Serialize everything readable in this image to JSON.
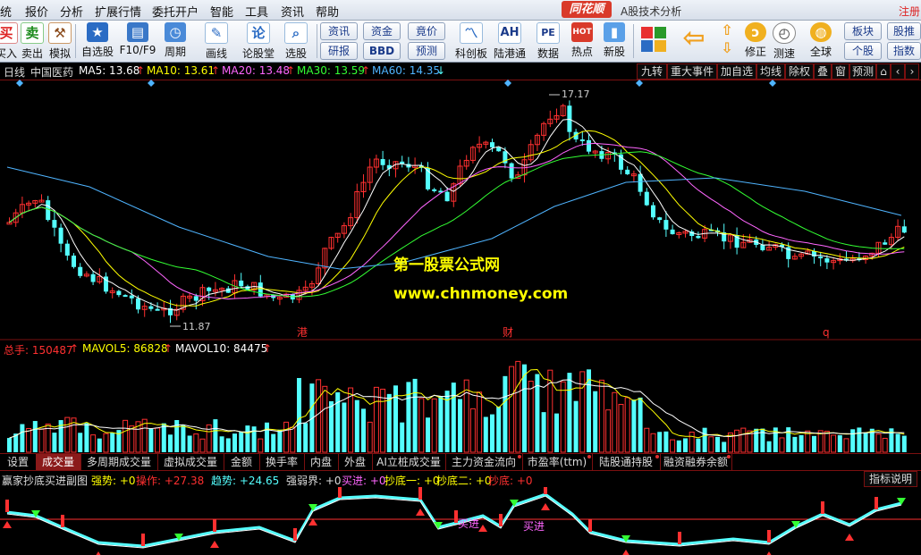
{
  "menu": {
    "items": [
      "统",
      "报价",
      "分析",
      "扩展行情",
      "委托开户",
      "智能",
      "工具",
      "资讯",
      "帮助"
    ],
    "brand": "同花顺",
    "title": "A股技术分析",
    "register": "注册"
  },
  "toolbar": {
    "buy": "买入",
    "sell": "卖出",
    "simulate": "模拟",
    "watchlist": "自选股",
    "f10": "F10/F9",
    "period": "周期",
    "draw": "画线",
    "forum": "论股堂",
    "pick": "选股",
    "news": "资讯",
    "research": "研报",
    "capital": "资金",
    "bbd": "BBD",
    "auction": "竟价",
    "forecast": "预测",
    "sci": "科创板",
    "hk": "陆港通",
    "data": "数据",
    "hot": "热点",
    "newstock": "新股",
    "fix": "修正",
    "test": "测速",
    "global": "全球",
    "sector": "板块",
    "individual": "个股",
    "stockpush": "股推",
    "index": "指数",
    "ah_icon": "AH",
    "hot_icon": "HOT",
    "pe_icon": "PE",
    "hk_icon": "港"
  },
  "infobar": {
    "period": "日线",
    "stock": "中国医药",
    "ma5": "MA5: 13.68",
    "ma10": "MA10: 13.61",
    "ma20": "MA20: 13.48",
    "ma30": "MA30: 13.59",
    "ma60": "MA60: 14.35",
    "buttons": [
      "九转",
      "重大事件",
      "加自选",
      "均线",
      "除权",
      "叠",
      "窗",
      "预测"
    ]
  },
  "chart_labels": {
    "high": "17.17",
    "low": "11.87",
    "watermark1": "第一股票公式网",
    "watermark2": "www.chnmoney.com",
    "event1": "港",
    "event2": "财",
    "event3": "q"
  },
  "volbar": {
    "total": "总手: 150487",
    "mavol5": "MAVOL5: 86828",
    "mavol10": "MAVOL10: 84475"
  },
  "tabs": [
    "设置",
    "成交量",
    "多周期成交量",
    "虚拟成交量",
    "金额",
    "换手率",
    "内盘",
    "外盘",
    "AI立桩成交量",
    "主力资金流向",
    "市盈率(ttm)",
    "陆股通持股",
    "融资融券余额"
  ],
  "indicator": {
    "name": "赢家抄底买进副图",
    "strength": "强势: +0",
    "operate": "操作: +27.38",
    "trend": "趋势: +24.65",
    "bound": "强弱界: +0",
    "buy": "买进: +0",
    "bottom1": "抄底一: +0",
    "bottom2": "抄底二: +0",
    "bottom": "抄底: +0",
    "explain": "指标说明",
    "label_buy": "买进"
  },
  "colors": {
    "up": "#ff3030",
    "down": "#54ffff",
    "ma5": "#ffffff",
    "ma10": "#ffff00",
    "ma20": "#ff66ff",
    "ma30": "#33ff33",
    "ma60": "#4fb4ff",
    "axis": "#7a1010"
  }
}
